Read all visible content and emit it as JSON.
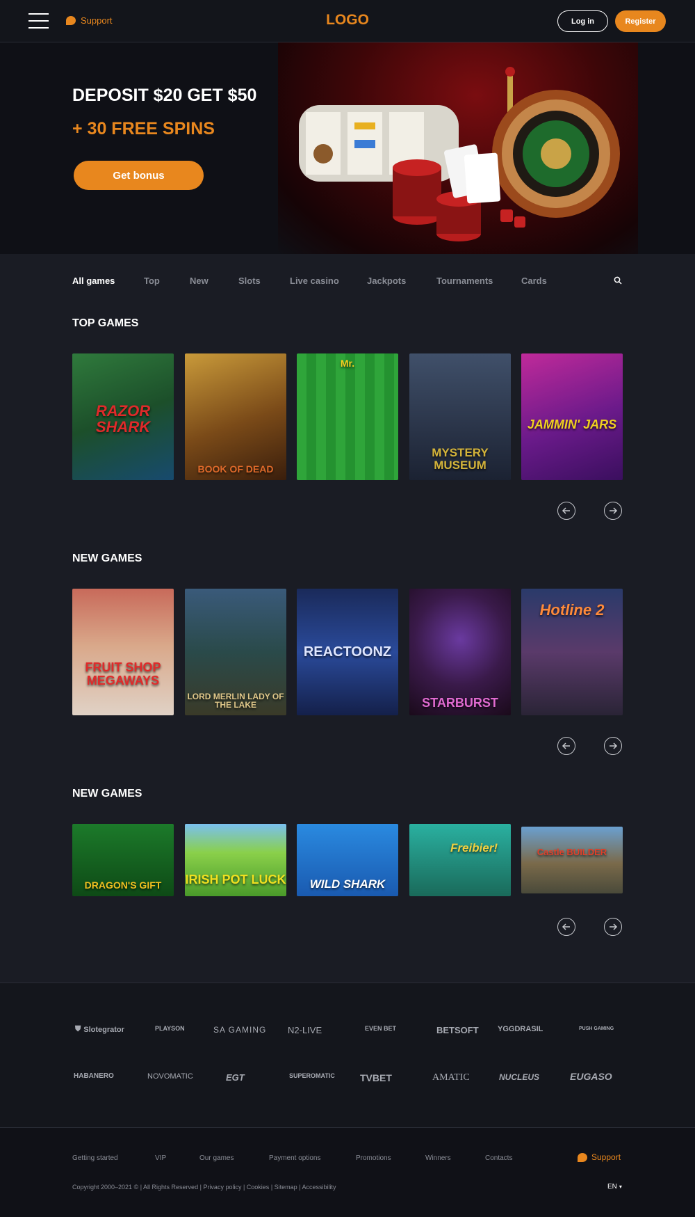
{
  "header": {
    "support_label": "Support",
    "logo_text": "LOGO",
    "login_label": "Log in",
    "register_label": "Register"
  },
  "hero": {
    "title": "DEPOSIT $20 GET $50",
    "subtitle": "+ 30 FREE SPINS",
    "button_label": "Get bonus"
  },
  "tabs": [
    "All games",
    "Top",
    "New",
    "Slots",
    "Live casino",
    "Jackpots",
    "Tournaments",
    "Cards"
  ],
  "sections": [
    {
      "title": "TOP GAMES",
      "games": [
        "RAZOR SHARK",
        "BOOK OF DEAD",
        "Mr.",
        "MYSTERY MUSEUM",
        "JAMMIN' JARS"
      ]
    },
    {
      "title": "NEW GAMES",
      "games": [
        "FRUIT SHOP MEGAWAYS",
        "LORD MERLIN LADY OF THE LAKE",
        "REACTOONZ",
        "STARBURST",
        "Hotline 2"
      ]
    },
    {
      "title": "NEW GAMES",
      "games": [
        "DRAGON'S GIFT",
        "IRISH POT LUCK",
        "WILD SHARK",
        "Freibier!",
        "Castle BUILDER"
      ]
    }
  ],
  "providers_row1": [
    "Slotegrator",
    "PLAYSON",
    "SA GAMING",
    "N2-LIVE",
    "EVEN BET",
    "BETSOFT",
    "YGGDRASIL",
    "PUSH GAMING"
  ],
  "providers_row2": [
    "HABANERO",
    "NOVOMATIC",
    "EGT",
    "SUPEROMATIC",
    "TVBET",
    "AMATIC",
    "NUCLEUS",
    "EUGASO"
  ],
  "footer": {
    "links": [
      "Getting started",
      "VIP",
      "Our games",
      "Payment options",
      "Promotions",
      "Winners",
      "Contacts"
    ],
    "support_label": "Support",
    "copyright": "Copyright 2000–2021 © | All Rights Reserved |",
    "legal_links": [
      "Privacy policy",
      "Cookies",
      "Sitemap",
      "Accessibility"
    ],
    "language": "EN"
  },
  "colors": {
    "accent": "#e8871e",
    "background": "#1a1c24",
    "header_bg": "#13151b"
  }
}
